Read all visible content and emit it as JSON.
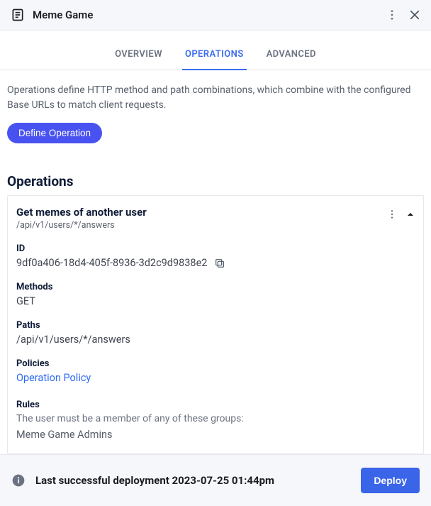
{
  "header": {
    "title": "Meme Game"
  },
  "tabs": {
    "overview": "OVERVIEW",
    "operations": "OPERATIONS",
    "advanced": "ADVANCED"
  },
  "intro": {
    "description": "Operations define HTTP method and path combinations, which combine with the configured Base URLs to match client requests.",
    "define_button": "Define Operation"
  },
  "operations_section": {
    "heading": "Operations",
    "item": {
      "title": "Get memes of another user",
      "route": "/api/v1/users/*/answers",
      "id_label": "ID",
      "id_value": "9df0a406-18d4-405f-8936-3d2c9d9838e2",
      "methods_label": "Methods",
      "methods_value": "GET",
      "paths_label": "Paths",
      "paths_value": "/api/v1/users/*/answers",
      "policies_label": "Policies",
      "policies_link": "Operation Policy",
      "rules_label": "Rules",
      "rules_desc": "The user must be a member of any of these groups:",
      "rules_group": "Meme Game Admins"
    }
  },
  "footer": {
    "status": "Last successful deployment 2023-07-25 01:44pm",
    "deploy": "Deploy"
  }
}
